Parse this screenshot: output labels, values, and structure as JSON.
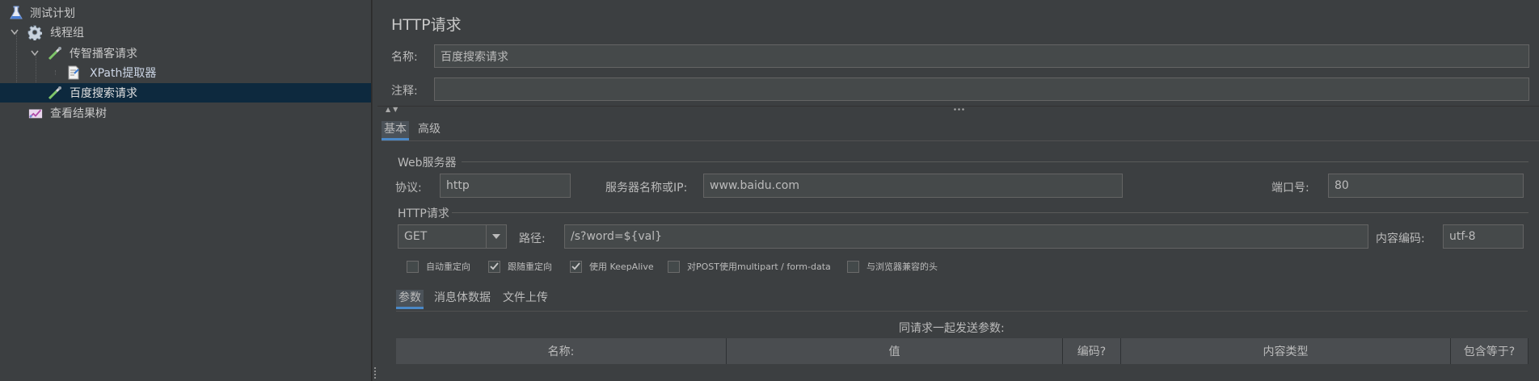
{
  "tree": {
    "items": [
      {
        "label": "测试计划",
        "icon": "flask-icon"
      },
      {
        "label": "线程组",
        "icon": "gear-icon"
      },
      {
        "label": "传智播客请求",
        "icon": "pipette-icon"
      },
      {
        "label": "XPath提取器",
        "icon": "document-icon"
      },
      {
        "label": "百度搜索请求",
        "icon": "pipette-icon"
      },
      {
        "label": "查看结果树",
        "icon": "chart-icon"
      }
    ]
  },
  "panel": {
    "title": "HTTP请求",
    "name_label": "名称:",
    "name_value": "百度搜索请求",
    "comment_label": "注释:",
    "comment_value": ""
  },
  "tabs": [
    "基本",
    "高级"
  ],
  "web_server": {
    "group_title": "Web服务器",
    "protocol_label": "协议:",
    "protocol_value": "http",
    "server_label": "服务器名称或IP:",
    "server_value": "www.baidu.com",
    "port_label": "端口号:",
    "port_value": "80"
  },
  "http_request": {
    "group_title": "HTTP请求",
    "method": "GET",
    "path_label": "路径:",
    "path_value": "/s?word=${val}",
    "encoding_label": "内容编码:",
    "encoding_value": "utf-8"
  },
  "options": [
    {
      "label": "自动重定向",
      "checked": false
    },
    {
      "label": "跟随重定向",
      "checked": true
    },
    {
      "label": "使用 KeepAlive",
      "checked": true
    },
    {
      "label": "对POST使用multipart / form-data",
      "checked": false
    },
    {
      "label": "与浏览器兼容的头",
      "checked": false
    }
  ],
  "subtabs": [
    "参数",
    "消息体数据",
    "文件上传"
  ],
  "params": {
    "caption": "同请求一起发送参数:",
    "columns": [
      "名称:",
      "值",
      "编码?",
      "内容类型",
      "包含等于?"
    ]
  },
  "colors": {
    "background": "#3c3f41",
    "selection": "#0d293e",
    "accent": "#4a88c7"
  }
}
